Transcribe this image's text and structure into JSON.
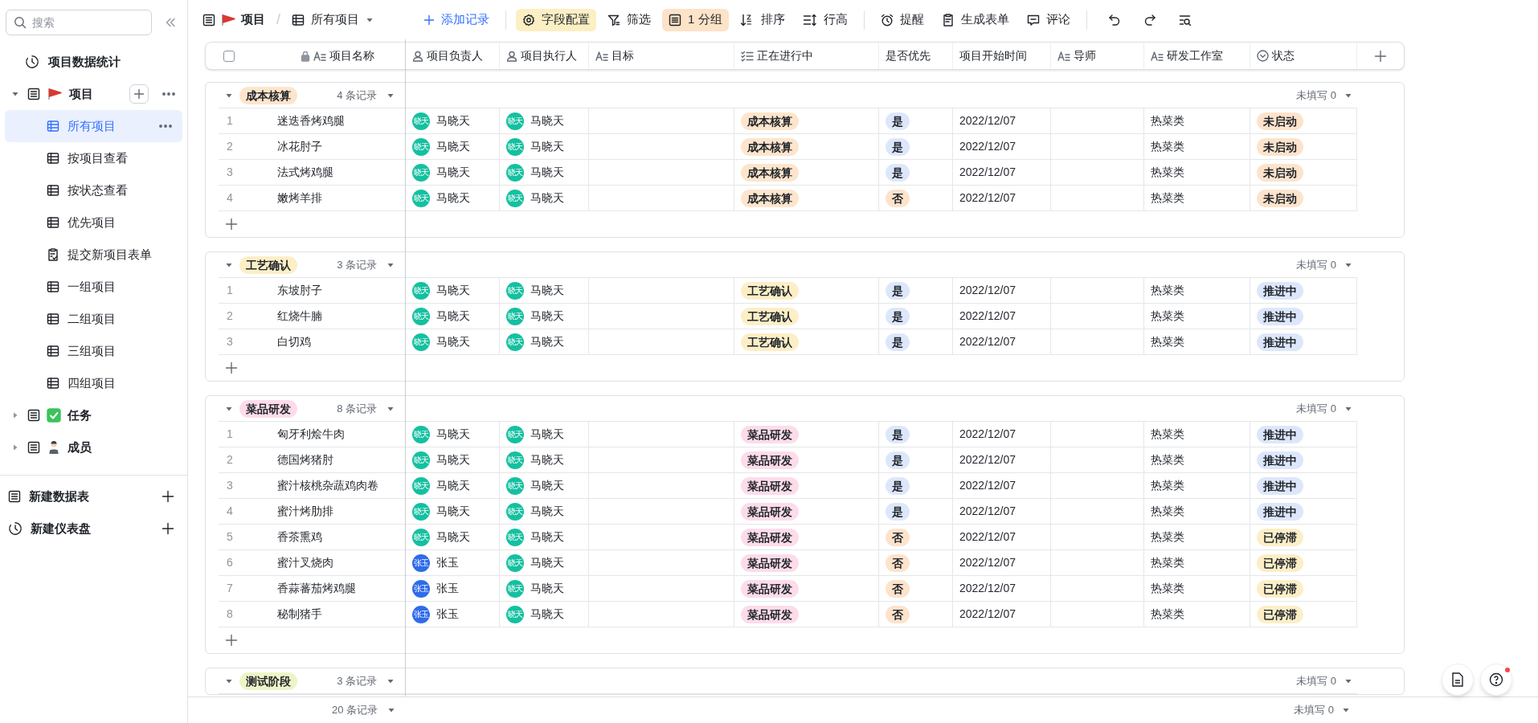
{
  "sidebar": {
    "search": {
      "placeholder": "搜索"
    },
    "items": [
      {
        "kind": "dashboard",
        "label": "项目数据统计"
      },
      {
        "kind": "table",
        "label": "项目",
        "expanded": true,
        "children": [
          {
            "kind": "grid",
            "label": "所有项目",
            "selected": true
          },
          {
            "kind": "grid",
            "label": "按项目查看",
            "selected": false
          },
          {
            "kind": "grid",
            "label": "按状态查看",
            "selected": false
          },
          {
            "kind": "grid",
            "label": "优先项目",
            "selected": false
          },
          {
            "kind": "form",
            "label": "提交新项目表单",
            "selected": false
          },
          {
            "kind": "grid",
            "label": "一组项目",
            "selected": false
          },
          {
            "kind": "grid",
            "label": "二组项目",
            "selected": false
          },
          {
            "kind": "grid",
            "label": "三组项目",
            "selected": false
          },
          {
            "kind": "grid",
            "label": "四组项目",
            "selected": false
          }
        ]
      },
      {
        "kind": "table",
        "label": "任务",
        "expanded": false
      },
      {
        "kind": "table",
        "label": "成员",
        "expanded": false
      }
    ],
    "actions": [
      {
        "kind": "table",
        "label": "新建数据表"
      },
      {
        "kind": "dashboard",
        "label": "新建仪表盘"
      }
    ]
  },
  "toolbar": {
    "breadcrumb": "项目",
    "separator": "/",
    "view": "所有项目",
    "items": [
      {
        "kind": "add",
        "label": "添加记录"
      },
      {
        "kind": "fields",
        "label": "字段配置",
        "color": "#fcefc4"
      },
      {
        "kind": "filter",
        "label": "筛选"
      },
      {
        "kind": "group",
        "label": "1 分组",
        "color": "#fde3c8"
      },
      {
        "kind": "sort",
        "label": "排序"
      },
      {
        "kind": "height",
        "label": "行高"
      },
      {
        "kind": "remind",
        "label": "提醒"
      },
      {
        "kind": "form",
        "label": "生成表单"
      },
      {
        "kind": "comment",
        "label": "评论"
      }
    ]
  },
  "table": {
    "select_all": {
      "checked": false
    },
    "columns": [
      {
        "kind": "primary",
        "label": "项目名称"
      },
      {
        "kind": "person",
        "label": "项目负责人"
      },
      {
        "kind": "person",
        "label": "项目执行人"
      },
      {
        "kind": "text",
        "label": "目标"
      },
      {
        "kind": "list",
        "label": "正在进行中"
      },
      {
        "kind": "plain",
        "label": "是否优先"
      },
      {
        "kind": "plain",
        "label": "项目开始时间"
      },
      {
        "kind": "text",
        "label": "导师"
      },
      {
        "kind": "text",
        "label": "研发工作室"
      },
      {
        "kind": "status",
        "label": "状态"
      }
    ],
    "groups": [
      {
        "label": "成本核算",
        "color": "#fde5cc",
        "count": "4 条记录",
        "unfilled": "未填写 0",
        "rows": [
          {
            "num": "1",
            "name": "迷迭香烤鸡腿",
            "owner": {
              "avatar": "晓天",
              "name": "马晓天",
              "color": "#14c0a0"
            },
            "executor": {
              "avatar": "晓天",
              "name": "马晓天",
              "color": "#14c0a0"
            },
            "stage": {
              "label": "成本核算",
              "color": "#fde5cc"
            },
            "priority": {
              "label": "是",
              "color": "#dde7fb"
            },
            "date": "2022/12/07",
            "studio": "热菜类",
            "status": {
              "label": "未启动",
              "color": "#fde3cc"
            }
          },
          {
            "num": "2",
            "name": "冰花肘子",
            "owner": {
              "avatar": "晓天",
              "name": "马晓天",
              "color": "#14c0a0"
            },
            "executor": {
              "avatar": "晓天",
              "name": "马晓天",
              "color": "#14c0a0"
            },
            "stage": {
              "label": "成本核算",
              "color": "#fde5cc"
            },
            "priority": {
              "label": "是",
              "color": "#dde7fb"
            },
            "date": "2022/12/07",
            "studio": "热菜类",
            "status": {
              "label": "未启动",
              "color": "#fde3cc"
            }
          },
          {
            "num": "3",
            "name": "法式烤鸡腿",
            "owner": {
              "avatar": "晓天",
              "name": "马晓天",
              "color": "#14c0a0"
            },
            "executor": {
              "avatar": "晓天",
              "name": "马晓天",
              "color": "#14c0a0"
            },
            "stage": {
              "label": "成本核算",
              "color": "#fde5cc"
            },
            "priority": {
              "label": "是",
              "color": "#dde7fb"
            },
            "date": "2022/12/07",
            "studio": "热菜类",
            "status": {
              "label": "未启动",
              "color": "#fde3cc"
            }
          },
          {
            "num": "4",
            "name": "嫩烤羊排",
            "owner": {
              "avatar": "晓天",
              "name": "马晓天",
              "color": "#14c0a0"
            },
            "executor": {
              "avatar": "晓天",
              "name": "马晓天",
              "color": "#14c0a0"
            },
            "stage": {
              "label": "成本核算",
              "color": "#fde5cc"
            },
            "priority": {
              "label": "否",
              "color": "#fde3cc"
            },
            "date": "2022/12/07",
            "studio": "热菜类",
            "status": {
              "label": "未启动",
              "color": "#fde3cc"
            }
          }
        ]
      },
      {
        "label": "工艺确认",
        "color": "#fcefc7",
        "count": "3 条记录",
        "unfilled": "未填写 0",
        "rows": [
          {
            "num": "1",
            "name": "东坡肘子",
            "owner": {
              "avatar": "晓天",
              "name": "马晓天",
              "color": "#14c0a0"
            },
            "executor": {
              "avatar": "晓天",
              "name": "马晓天",
              "color": "#14c0a0"
            },
            "stage": {
              "label": "工艺确认",
              "color": "#fcefc7"
            },
            "priority": {
              "label": "是",
              "color": "#dde7fb"
            },
            "date": "2022/12/07",
            "studio": "热菜类",
            "status": {
              "label": "推进中",
              "color": "#dde7fb"
            }
          },
          {
            "num": "2",
            "name": "红烧牛腩",
            "owner": {
              "avatar": "晓天",
              "name": "马晓天",
              "color": "#14c0a0"
            },
            "executor": {
              "avatar": "晓天",
              "name": "马晓天",
              "color": "#14c0a0"
            },
            "stage": {
              "label": "工艺确认",
              "color": "#fcefc7"
            },
            "priority": {
              "label": "是",
              "color": "#dde7fb"
            },
            "date": "2022/12/07",
            "studio": "热菜类",
            "status": {
              "label": "推进中",
              "color": "#dde7fb"
            }
          },
          {
            "num": "3",
            "name": "白切鸡",
            "owner": {
              "avatar": "晓天",
              "name": "马晓天",
              "color": "#14c0a0"
            },
            "executor": {
              "avatar": "晓天",
              "name": "马晓天",
              "color": "#14c0a0"
            },
            "stage": {
              "label": "工艺确认",
              "color": "#fcefc7"
            },
            "priority": {
              "label": "是",
              "color": "#dde7fb"
            },
            "date": "2022/12/07",
            "studio": "热菜类",
            "status": {
              "label": "推进中",
              "color": "#dde7fb"
            }
          }
        ]
      },
      {
        "label": "菜品研发",
        "color": "#fddcea",
        "count": "8 条记录",
        "unfilled": "未填写 0",
        "rows": [
          {
            "num": "1",
            "name": "匈牙利烩牛肉",
            "owner": {
              "avatar": "晓天",
              "name": "马晓天",
              "color": "#14c0a0"
            },
            "executor": {
              "avatar": "晓天",
              "name": "马晓天",
              "color": "#14c0a0"
            },
            "stage": {
              "label": "菜品研发",
              "color": "#fddcea"
            },
            "priority": {
              "label": "是",
              "color": "#dde7fb"
            },
            "date": "2022/12/07",
            "studio": "热菜类",
            "status": {
              "label": "推进中",
              "color": "#dde7fb"
            }
          },
          {
            "num": "2",
            "name": "德国烤猪肘",
            "owner": {
              "avatar": "晓天",
              "name": "马晓天",
              "color": "#14c0a0"
            },
            "executor": {
              "avatar": "晓天",
              "name": "马晓天",
              "color": "#14c0a0"
            },
            "stage": {
              "label": "菜品研发",
              "color": "#fddcea"
            },
            "priority": {
              "label": "是",
              "color": "#dde7fb"
            },
            "date": "2022/12/07",
            "studio": "热菜类",
            "status": {
              "label": "推进中",
              "color": "#dde7fb"
            }
          },
          {
            "num": "3",
            "name": "蜜汁核桃杂蔬鸡肉卷",
            "owner": {
              "avatar": "晓天",
              "name": "马晓天",
              "color": "#14c0a0"
            },
            "executor": {
              "avatar": "晓天",
              "name": "马晓天",
              "color": "#14c0a0"
            },
            "stage": {
              "label": "菜品研发",
              "color": "#fddcea"
            },
            "priority": {
              "label": "是",
              "color": "#dde7fb"
            },
            "date": "2022/12/07",
            "studio": "热菜类",
            "status": {
              "label": "推进中",
              "color": "#dde7fb"
            }
          },
          {
            "num": "4",
            "name": "蜜汁烤肋排",
            "owner": {
              "avatar": "晓天",
              "name": "马晓天",
              "color": "#14c0a0"
            },
            "executor": {
              "avatar": "晓天",
              "name": "马晓天",
              "color": "#14c0a0"
            },
            "stage": {
              "label": "菜品研发",
              "color": "#fddcea"
            },
            "priority": {
              "label": "是",
              "color": "#dde7fb"
            },
            "date": "2022/12/07",
            "studio": "热菜类",
            "status": {
              "label": "推进中",
              "color": "#dde7fb"
            }
          },
          {
            "num": "5",
            "name": "香茶熏鸡",
            "owner": {
              "avatar": "晓天",
              "name": "马晓天",
              "color": "#14c0a0"
            },
            "executor": {
              "avatar": "晓天",
              "name": "马晓天",
              "color": "#14c0a0"
            },
            "stage": {
              "label": "菜品研发",
              "color": "#fddcea"
            },
            "priority": {
              "label": "否",
              "color": "#fde3cc"
            },
            "date": "2022/12/07",
            "studio": "热菜类",
            "status": {
              "label": "已停滞",
              "color": "#fcefc7"
            }
          },
          {
            "num": "6",
            "name": "蜜汁叉烧肉",
            "owner": {
              "avatar": "张玉",
              "name": "张玉",
              "color": "#2f6bea"
            },
            "executor": {
              "avatar": "晓天",
              "name": "马晓天",
              "color": "#14c0a0"
            },
            "stage": {
              "label": "菜品研发",
              "color": "#fddcea"
            },
            "priority": {
              "label": "否",
              "color": "#fde3cc"
            },
            "date": "2022/12/07",
            "studio": "热菜类",
            "status": {
              "label": "已停滞",
              "color": "#fcefc7"
            }
          },
          {
            "num": "7",
            "name": "香蒜蕃茄烤鸡腿",
            "owner": {
              "avatar": "张玉",
              "name": "张玉",
              "color": "#2f6bea"
            },
            "executor": {
              "avatar": "晓天",
              "name": "马晓天",
              "color": "#14c0a0"
            },
            "stage": {
              "label": "菜品研发",
              "color": "#fddcea"
            },
            "priority": {
              "label": "否",
              "color": "#fde3cc"
            },
            "date": "2022/12/07",
            "studio": "热菜类",
            "status": {
              "label": "已停滞",
              "color": "#fcefc7"
            }
          },
          {
            "num": "8",
            "name": "秘制猪手",
            "owner": {
              "avatar": "张玉",
              "name": "张玉",
              "color": "#2f6bea"
            },
            "executor": {
              "avatar": "晓天",
              "name": "马晓天",
              "color": "#14c0a0"
            },
            "stage": {
              "label": "菜品研发",
              "color": "#fddcea"
            },
            "priority": {
              "label": "否",
              "color": "#fde3cc"
            },
            "date": "2022/12/07",
            "studio": "热菜类",
            "status": {
              "label": "已停滞",
              "color": "#fcefc7"
            }
          }
        ]
      },
      {
        "label": "测试阶段",
        "color": "#eef4c8",
        "count": "3 条记录",
        "unfilled": "未填写 0"
      }
    ]
  },
  "footer": {
    "count": "20 条记录",
    "unfilled": "未填写 0"
  }
}
